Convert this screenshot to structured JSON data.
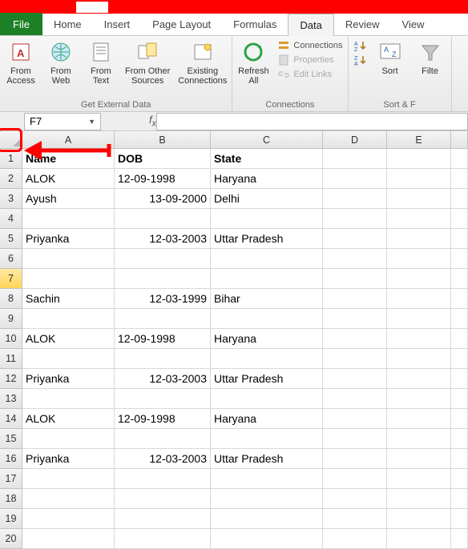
{
  "tabs": {
    "file": "File",
    "list": [
      "Home",
      "Insert",
      "Page Layout",
      "Formulas",
      "Data",
      "Review",
      "View"
    ],
    "active_index": 4
  },
  "ribbon": {
    "group_ext": {
      "label": "Get External Data",
      "btns": [
        "From\nAccess",
        "From\nWeb",
        "From\nText",
        "From Other\nSources",
        "Existing\nConnections"
      ]
    },
    "group_conn": {
      "label": "Connections",
      "refresh": "Refresh\nAll",
      "items": [
        "Connections",
        "Properties",
        "Edit Links"
      ]
    },
    "group_sort": {
      "label": "Sort & F",
      "sort": "Sort",
      "filter": "Filte"
    }
  },
  "namebox": "F7",
  "columns": [
    "A",
    "B",
    "C",
    "D",
    "E",
    ""
  ],
  "active_cell": {
    "row": 7,
    "col": "F"
  },
  "chart_data": {
    "type": "table",
    "headers": [
      "Name",
      "DOB",
      "State"
    ],
    "rows": [
      {
        "r": 1,
        "cells": [
          "Name",
          "DOB",
          "State"
        ],
        "bold": true
      },
      {
        "r": 2,
        "cells": [
          "ALOK",
          "12-09-1998",
          "Haryana"
        ],
        "align": [
          "l",
          "l",
          "l"
        ]
      },
      {
        "r": 3,
        "cells": [
          "Ayush",
          "13-09-2000",
          "Delhi"
        ],
        "align": [
          "l",
          "r",
          "l"
        ]
      },
      {
        "r": 4,
        "cells": [
          "",
          "",
          ""
        ]
      },
      {
        "r": 5,
        "cells": [
          "Priyanka",
          "12-03-2003",
          "Uttar Pradesh"
        ],
        "align": [
          "l",
          "r",
          "l"
        ]
      },
      {
        "r": 6,
        "cells": [
          "",
          "",
          ""
        ]
      },
      {
        "r": 7,
        "cells": [
          "",
          "",
          ""
        ]
      },
      {
        "r": 8,
        "cells": [
          "Sachin",
          "12-03-1999",
          "Bihar"
        ],
        "align": [
          "l",
          "r",
          "l"
        ]
      },
      {
        "r": 9,
        "cells": [
          "",
          "",
          ""
        ]
      },
      {
        "r": 10,
        "cells": [
          "ALOK",
          "12-09-1998",
          "Haryana"
        ],
        "align": [
          "l",
          "l",
          "l"
        ]
      },
      {
        "r": 11,
        "cells": [
          "",
          "",
          ""
        ]
      },
      {
        "r": 12,
        "cells": [
          "Priyanka",
          "12-03-2003",
          "Uttar Pradesh"
        ],
        "align": [
          "l",
          "r",
          "l"
        ]
      },
      {
        "r": 13,
        "cells": [
          "",
          "",
          ""
        ]
      },
      {
        "r": 14,
        "cells": [
          "ALOK",
          "12-09-1998",
          "Haryana"
        ],
        "align": [
          "l",
          "l",
          "l"
        ]
      },
      {
        "r": 15,
        "cells": [
          "",
          "",
          ""
        ]
      },
      {
        "r": 16,
        "cells": [
          "Priyanka",
          "12-03-2003",
          "Uttar Pradesh"
        ],
        "align": [
          "l",
          "r",
          "l"
        ]
      },
      {
        "r": 17,
        "cells": [
          "",
          "",
          ""
        ]
      },
      {
        "r": 18,
        "cells": [
          "",
          "",
          ""
        ]
      },
      {
        "r": 19,
        "cells": [
          "",
          "",
          ""
        ]
      },
      {
        "r": 20,
        "cells": [
          "",
          "",
          ""
        ]
      }
    ]
  }
}
